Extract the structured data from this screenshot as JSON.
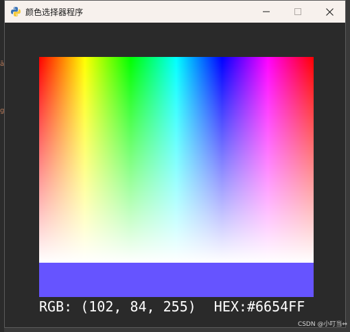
{
  "window": {
    "title": "颜色选择器程序",
    "app_icon": "python-icon",
    "controls": {
      "minimize_icon": "minimize-icon",
      "maximize_icon": "maximize-icon",
      "close_icon": "close-icon"
    }
  },
  "picker": {
    "hues": [
      "#ff0000",
      "#ffff00",
      "#00ff00",
      "#00ffff",
      "#0000ff",
      "#ff00ff",
      "#ff0000"
    ],
    "bottom_fade": "#ffffff"
  },
  "selected": {
    "swatch_color": "#6654FF",
    "rgb_text": "RGB: (102, 84, 255)",
    "hex_text": "HEX:#6654FF"
  },
  "watermark": "CSDN @小叮当⇔",
  "colors": {
    "titlebar": "#f7f1ed",
    "client_bg": "#2a2a2a",
    "text": "#ffffff"
  }
}
